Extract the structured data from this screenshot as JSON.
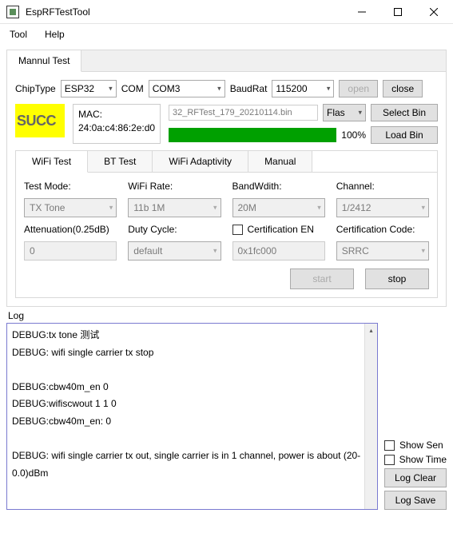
{
  "window": {
    "title": "EspRFTestTool"
  },
  "menu": {
    "tool": "Tool",
    "help": "Help"
  },
  "main_tab": {
    "label": "Mannul Test"
  },
  "conn": {
    "chip_label": "ChipType",
    "chip_value": "ESP32",
    "com_label": "COM",
    "com_value": "COM3",
    "baud_label": "BaudRat",
    "baud_value": "115200",
    "open": "open",
    "close": "close"
  },
  "status": {
    "succ": "SUCC",
    "mac_label": "MAC:",
    "mac_value": "24:0a:c4:86:2e:d0",
    "bin_name": "32_RFTest_179_20210114.bin",
    "flash_mode": "Flas",
    "select_bin": "Select Bin",
    "load_bin": "Load Bin",
    "progress_pct": "100%",
    "progress_value": 100
  },
  "inner_tabs": {
    "wifi": "WiFi Test",
    "bt": "BT Test",
    "adap": "WiFi Adaptivity",
    "manual": "Manual"
  },
  "wifi": {
    "test_mode_label": "Test Mode:",
    "test_mode_value": "TX Tone",
    "wifi_rate_label": "WiFi Rate:",
    "wifi_rate_value": "11b 1M",
    "bandwidth_label": "BandWdith:",
    "bandwidth_value": "20M",
    "channel_label": "Channel:",
    "channel_value": "1/2412",
    "atten_label": "Attenuation(0.25dB)",
    "atten_value": "0",
    "duty_label": "Duty Cycle:",
    "duty_value": "default",
    "cert_en_label": "Certification EN",
    "cert_code_label": "Certification Code:",
    "cert_code_value": "SRRC",
    "cert_hex": "0x1fc000",
    "start": "start",
    "stop": "stop"
  },
  "log": {
    "label": "Log",
    "lines": [
      "DEBUG:tx tone 测试",
      "DEBUG: wifi single carrier tx stop",
      "",
      "DEBUG:cbw40m_en 0",
      "DEBUG:wifiscwout 1  1 0",
      "DEBUG:cbw40m_en: 0",
      "",
      "DEBUG: wifi single carrier tx out, single carrier is in 1 channel, power is about (20-0.0)dBm"
    ],
    "show_sen": "Show Sen",
    "show_time": "Show Time",
    "clear": "Log Clear",
    "save": "Log Save"
  }
}
